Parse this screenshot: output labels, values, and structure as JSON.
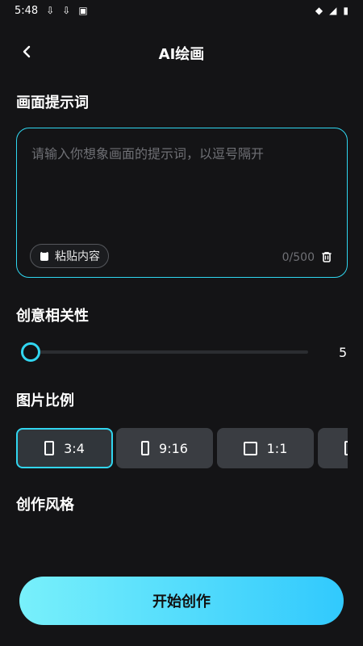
{
  "status_bar": {
    "time": "5:48"
  },
  "header": {
    "title": "AI绘画",
    "back_icon": "chevron-left-icon"
  },
  "prompt_section": {
    "title": "画面提示词",
    "placeholder": "请输入你想象画面的提示词，以逗号隔开",
    "paste_label": "粘贴内容",
    "count_label": "0/500"
  },
  "relevance": {
    "title": "创意相关性",
    "value": 5,
    "value_label": "5",
    "min": 5,
    "max": 100
  },
  "ratio_section": {
    "title": "图片比例",
    "options": [
      {
        "label": "3:4",
        "selected": true
      },
      {
        "label": "9:16",
        "selected": false
      },
      {
        "label": "1:1",
        "selected": false
      },
      {
        "label": "",
        "selected": false
      }
    ]
  },
  "style_section": {
    "title": "创作风格"
  },
  "start_button": {
    "label": "开始创作"
  },
  "colors": {
    "background": "#141416",
    "accent": "#31d6f0",
    "chip": "#3a3d42"
  }
}
